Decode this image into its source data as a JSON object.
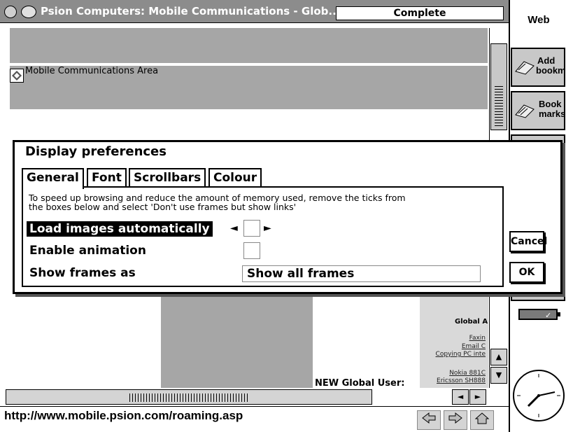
{
  "window": {
    "title": "Psion Computers: Mobile Communications - Glob...",
    "status": "Complete"
  },
  "page": {
    "area_title": "Mobile Communications Area",
    "global_heading": "Global A",
    "global_links": [
      "Faxin",
      "Email C",
      "Copying PC inte",
      "Nokia 881C",
      "Ericsson SH888"
    ],
    "new_global_user": "NEW Global User:"
  },
  "url": "http://www.mobile.psion.com/roaming.asp",
  "toolbar": {
    "title": "Web",
    "add_bookmark": {
      "line1": "Add",
      "line2": "bookmk"
    },
    "bookmarks": {
      "line1": "Book",
      "line2": "marks"
    }
  },
  "dialog": {
    "title": "Display preferences",
    "tabs": [
      "General",
      "Font",
      "Scrollbars",
      "Colour"
    ],
    "active_tab": "General",
    "help_line1": "To speed up browsing and reduce the amount of memory used, remove the ticks from",
    "help_line2": "the boxes below and select 'Don't use frames but show links'",
    "load_images_label": "Load images automatically",
    "load_images_checked": false,
    "enable_animation_label": "Enable animation",
    "enable_animation_checked": false,
    "show_frames_label": "Show frames as",
    "show_frames_value": "Show all frames",
    "cancel_label": "Cancel",
    "ok_label": "OK"
  },
  "icons": {
    "scroll_up": "▲",
    "scroll_down": "▼",
    "scroll_left": "◄",
    "scroll_right": "►",
    "prev_option": "◄",
    "next_option": "►"
  }
}
